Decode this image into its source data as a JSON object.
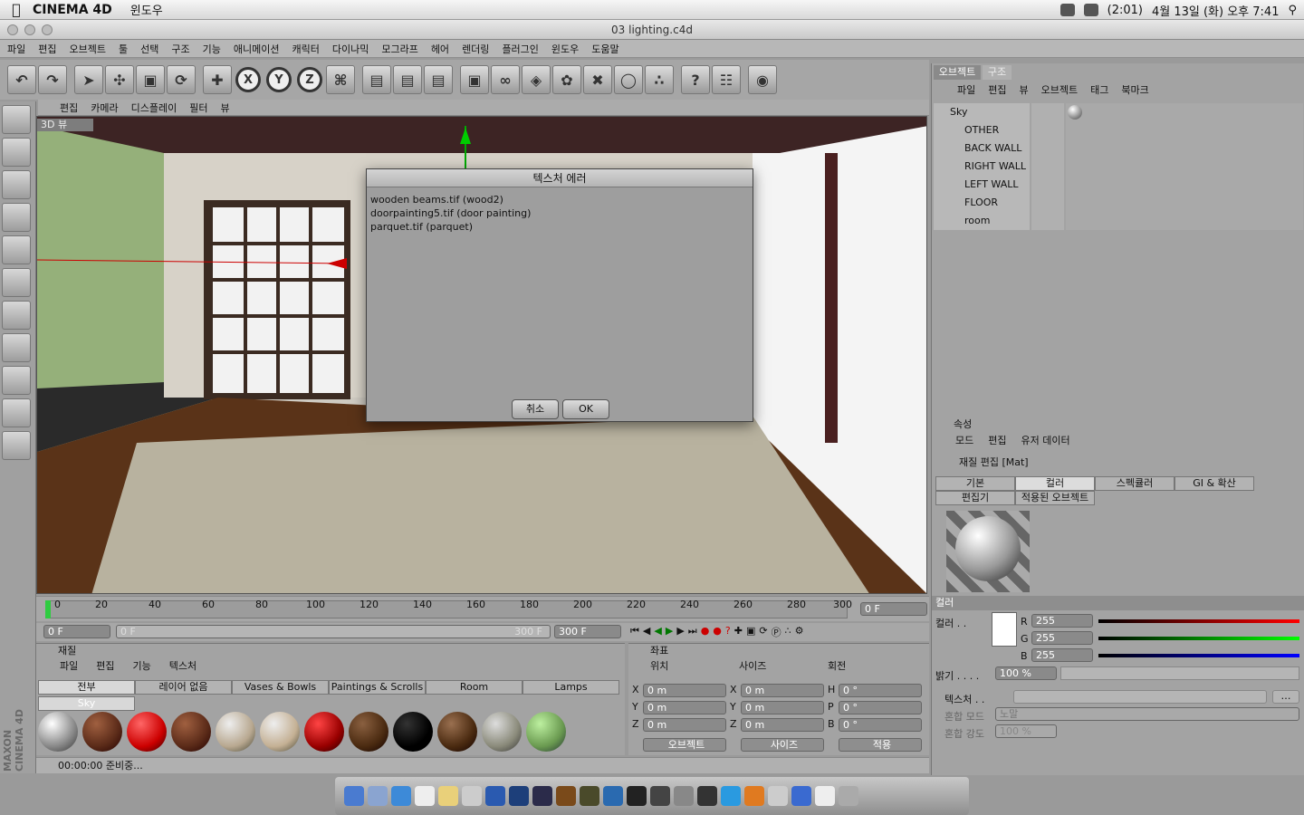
{
  "menubar": {
    "app": "CINEMA 4D",
    "menu": "윈도우",
    "battery": "(2:01)",
    "datetime": "4월 13일 (화) 오후  7:41"
  },
  "window": {
    "title": "03 lighting.c4d"
  },
  "appmenu": [
    "파일",
    "편집",
    "오브젝트",
    "툴",
    "선택",
    "구조",
    "기능",
    "애니메이션",
    "캐릭터",
    "다이나믹",
    "모그라프",
    "헤어",
    "렌더링",
    "플러그인",
    "윈도우",
    "도움말"
  ],
  "toolbar": {
    "x": "X",
    "y": "Y",
    "z": "Z"
  },
  "viewport": {
    "menu": [
      "편집",
      "카메라",
      "디스플레이",
      "필터",
      "뷰"
    ],
    "label": "3D 뷰"
  },
  "dialog": {
    "title": "텍스처 에러",
    "lines": [
      "wooden beams.tif (wood2)",
      "doorpainting5.tif (door painting)",
      "parquet.tif (parquet)"
    ],
    "cancel": "취소",
    "ok": "OK"
  },
  "timeline": {
    "ticks": [
      "0",
      "20",
      "40",
      "60",
      "80",
      "100",
      "120",
      "140",
      "160",
      "180",
      "200",
      "220",
      "240",
      "260",
      "280",
      "300"
    ],
    "frame": "0 F"
  },
  "transport": {
    "start": "0 F",
    "min": "0 F",
    "max": "300 F",
    "end": "300 F"
  },
  "materials": {
    "title": "재질",
    "menu": [
      "파일",
      "편집",
      "기능",
      "텍스처"
    ],
    "tabs": [
      "전부",
      "레이어 없음",
      "Vases & Bowls",
      "Paintings & Scrolls",
      "Room",
      "Lamps"
    ],
    "sky": "Sky"
  },
  "coords": {
    "title": "좌표",
    "headers": [
      "위치",
      "사이즈",
      "회전"
    ],
    "rows": [
      {
        "a": "X",
        "v1": "0 m",
        "b": "X",
        "v2": "0 m",
        "c": "H",
        "v3": "0 °"
      },
      {
        "a": "Y",
        "v1": "0 m",
        "b": "Y",
        "v2": "0 m",
        "c": "P",
        "v3": "0 °"
      },
      {
        "a": "Z",
        "v1": "0 m",
        "b": "Z",
        "v2": "0 m",
        "c": "B",
        "v3": "0 °"
      }
    ],
    "mode1": "오브젝트",
    "mode2": "사이즈",
    "apply": "적용"
  },
  "status": "00:00:00 준비중...",
  "objects": {
    "tabs": [
      "오브젝트",
      "구조"
    ],
    "menu": [
      "파일",
      "편집",
      "뷰",
      "오브젝트",
      "태그",
      "북마크"
    ],
    "items": [
      "Sky",
      "OTHER",
      "BACK WALL",
      "RIGHT WALL",
      "LEFT WALL",
      "FLOOR",
      "room"
    ]
  },
  "attributes": {
    "title": "속성",
    "menu": [
      "모드",
      "편집",
      "유저 데이터"
    ],
    "matname": "재질 편집 [Mat]",
    "tabs": [
      "기본",
      "컬러",
      "스펙큘러",
      "GI & 확산"
    ],
    "tabs2": [
      "편집기",
      "적용된 오브젝트"
    ],
    "section": "컬러",
    "color_label": "컬러 . .",
    "r": "255",
    "g": "255",
    "b": "255",
    "brightness_label": "밝기 . . . .",
    "brightness": "100 %",
    "texture_label": "텍스처 . .",
    "mix_mode_label": "혼합 모드",
    "mix_mode": "노말",
    "mix_strength_label": "혼합 강도",
    "mix_strength": "100 %",
    "R": "R",
    "G": "G",
    "B": "B"
  },
  "brand": "MAXON CINEMA 4D"
}
